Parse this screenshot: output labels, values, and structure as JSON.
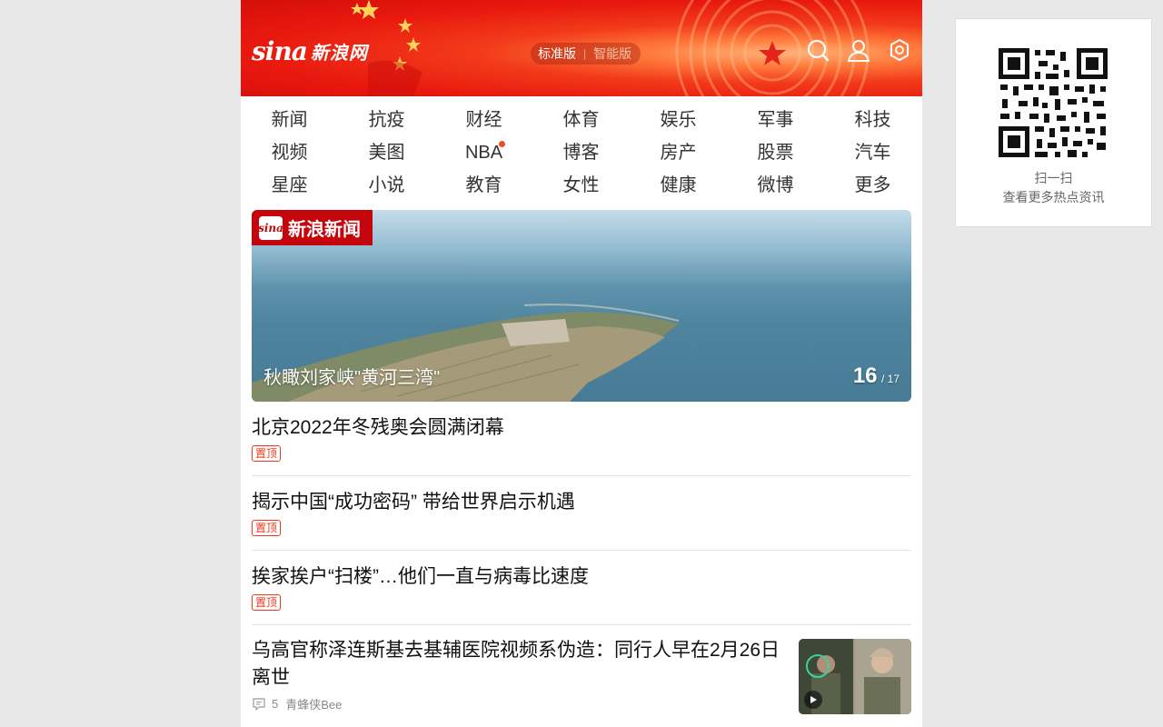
{
  "header": {
    "logo_sina": "sina",
    "logo_cn": "新浪网",
    "version_active": "标准版",
    "version_inactive": "智能版",
    "icons": [
      "search-icon",
      "user-icon",
      "settings-icon"
    ]
  },
  "nav": {
    "rows": [
      [
        "新闻",
        "抗疫",
        "财经",
        "体育",
        "娱乐",
        "军事",
        "科技"
      ],
      [
        "视频",
        "美图",
        "NBA",
        "博客",
        "房产",
        "股票",
        "汽车"
      ],
      [
        "星座",
        "小说",
        "教育",
        "女性",
        "健康",
        "微博",
        "更多"
      ]
    ],
    "dot_item": "NBA"
  },
  "banner": {
    "badge_icon": "sina",
    "badge_text": "新浪新闻",
    "caption": "秋瞰刘家峡\"黄河三湾\"",
    "current": "16",
    "total": "/ 17"
  },
  "feed": {
    "items": [
      {
        "title": "北京2022年冬残奥会圆满闭幕",
        "tag": "置顶"
      },
      {
        "title": "揭示中国“成功密码” 带给世界启示机遇",
        "tag": "置顶"
      },
      {
        "title": "挨家挨户“扫楼”…他们一直与病毒比速度",
        "tag": "置顶"
      }
    ],
    "video_item": {
      "title": "乌高官称泽连斯基去基辅医院视频系伪造：同行人早在2月26日离世",
      "comments": "5",
      "source": "青蜂侠Bee"
    }
  },
  "qr": {
    "line1": "扫一扫",
    "line2": "查看更多热点资讯"
  },
  "colors": {
    "brand_red": "#e8180e",
    "tag_red": "#f0381e",
    "badge_red": "#c4060c"
  }
}
